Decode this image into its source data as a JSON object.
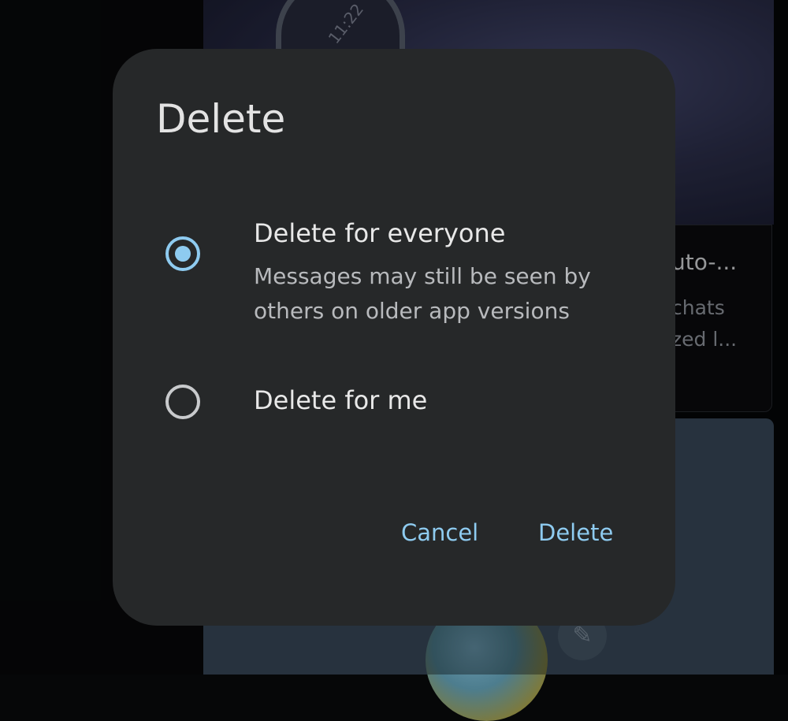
{
  "background": {
    "clock_text": "11:22",
    "card_title": "uto-...",
    "card_line1": "chats",
    "card_line2": "zed l..."
  },
  "dialog": {
    "title": "Delete",
    "options": [
      {
        "label": "Delete for everyone",
        "description": "Messages may still be seen by others on older app versions",
        "selected": true
      },
      {
        "label": "Delete for me",
        "selected": false
      }
    ],
    "cancel_label": "Cancel",
    "confirm_label": "Delete"
  },
  "colors": {
    "accent": "#8ecbf0",
    "dialog_surface": "#262829",
    "text_primary": "#e8e8e8",
    "text_secondary": "#b8babd"
  },
  "icons": {
    "selected_radio": "radio-selected-icon",
    "unselected_radio": "radio-unselected-icon",
    "fab": "pencil-icon"
  }
}
